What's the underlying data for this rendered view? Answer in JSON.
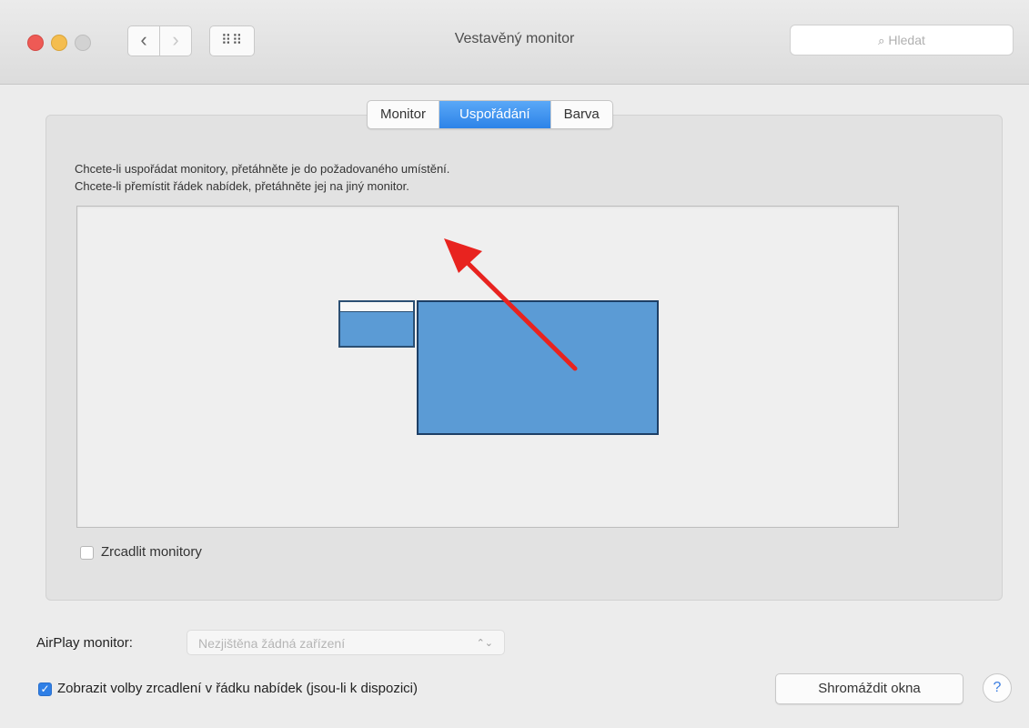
{
  "window": {
    "title": "Vestavěný monitor",
    "search_placeholder": "Hledat"
  },
  "toolbar": {
    "back_icon": "chevron-left-icon",
    "back_glyph": "‹",
    "forward_icon": "chevron-right-icon",
    "forward_glyph": "›",
    "grid_icon": "grid-icon",
    "grid_glyph": "⠿⠿"
  },
  "tabs": [
    {
      "label": "Monitor",
      "active": false
    },
    {
      "label": "Uspořádání",
      "active": true
    },
    {
      "label": "Barva",
      "active": false
    }
  ],
  "arrangement": {
    "instruction_1": "Chcete-li uspořádat monitory, přetáhněte je do požadovaného umístění.",
    "instruction_2": "Chcete-li přemístit řádek nabídek, přetáhněte jej na jiný monitor.",
    "mirror_label": "Zrcadlit monitory",
    "mirror_checked": false
  },
  "airplay": {
    "label": "AirPlay monitor:",
    "value": "Nezjištěna žádná zařízení",
    "chevron": "⌃⌄"
  },
  "show_mirroring": {
    "label": "Zobrazit volby zrcadlení v řádku nabídek (jsou-li k dispozici)",
    "checked": true,
    "check_glyph": "✓"
  },
  "buttons": {
    "gather_windows": "Shromáždit okna",
    "help": "?"
  },
  "colors": {
    "accent": "#2f7fe6",
    "monitor_fill": "#5b9bd5",
    "arrow": "#e8231f"
  }
}
